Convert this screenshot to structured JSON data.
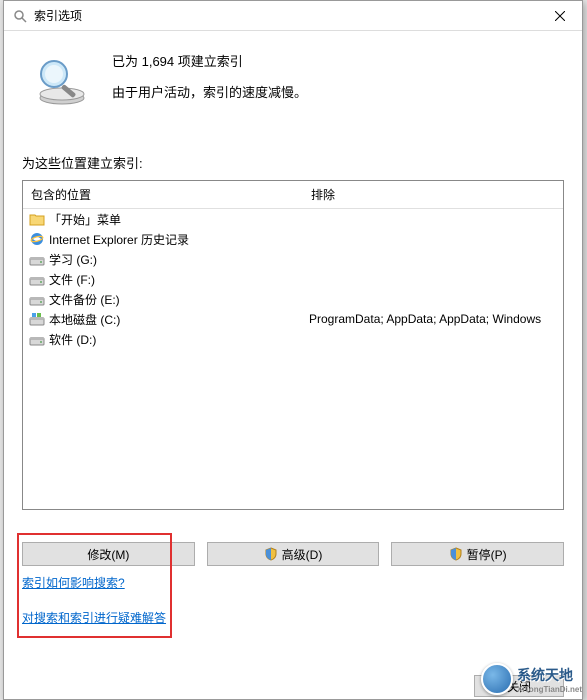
{
  "title": "索引选项",
  "status": {
    "count_line": "已为 1,694 项建立索引",
    "speed_line": "由于用户活动，索引的速度减慢。"
  },
  "section_label": "为这些位置建立索引:",
  "columns": {
    "included": "包含的位置",
    "excluded": "排除"
  },
  "locations": [
    {
      "icon": "folder",
      "name": "「开始」菜单",
      "excluded": ""
    },
    {
      "icon": "ie",
      "name": "Internet Explorer 历史记录",
      "excluded": ""
    },
    {
      "icon": "disk",
      "name": "学习 (G:)",
      "excluded": ""
    },
    {
      "icon": "disk",
      "name": "文件 (F:)",
      "excluded": ""
    },
    {
      "icon": "disk",
      "name": "文件备份 (E:)",
      "excluded": ""
    },
    {
      "icon": "cdisk",
      "name": "本地磁盘 (C:)",
      "excluded": "ProgramData; AppData; AppData; Windows"
    },
    {
      "icon": "disk",
      "name": "软件 (D:)",
      "excluded": ""
    }
  ],
  "buttons": {
    "modify": "修改(M)",
    "advanced": "高级(D)",
    "pause": "暂停(P)",
    "close": "关闭"
  },
  "links": {
    "how_affects": "索引如何影响搜索?",
    "troubleshoot": "对搜索和索引进行疑难解答"
  },
  "watermark": {
    "main": "系统天地",
    "sub": "XiTongTianDi.net"
  }
}
